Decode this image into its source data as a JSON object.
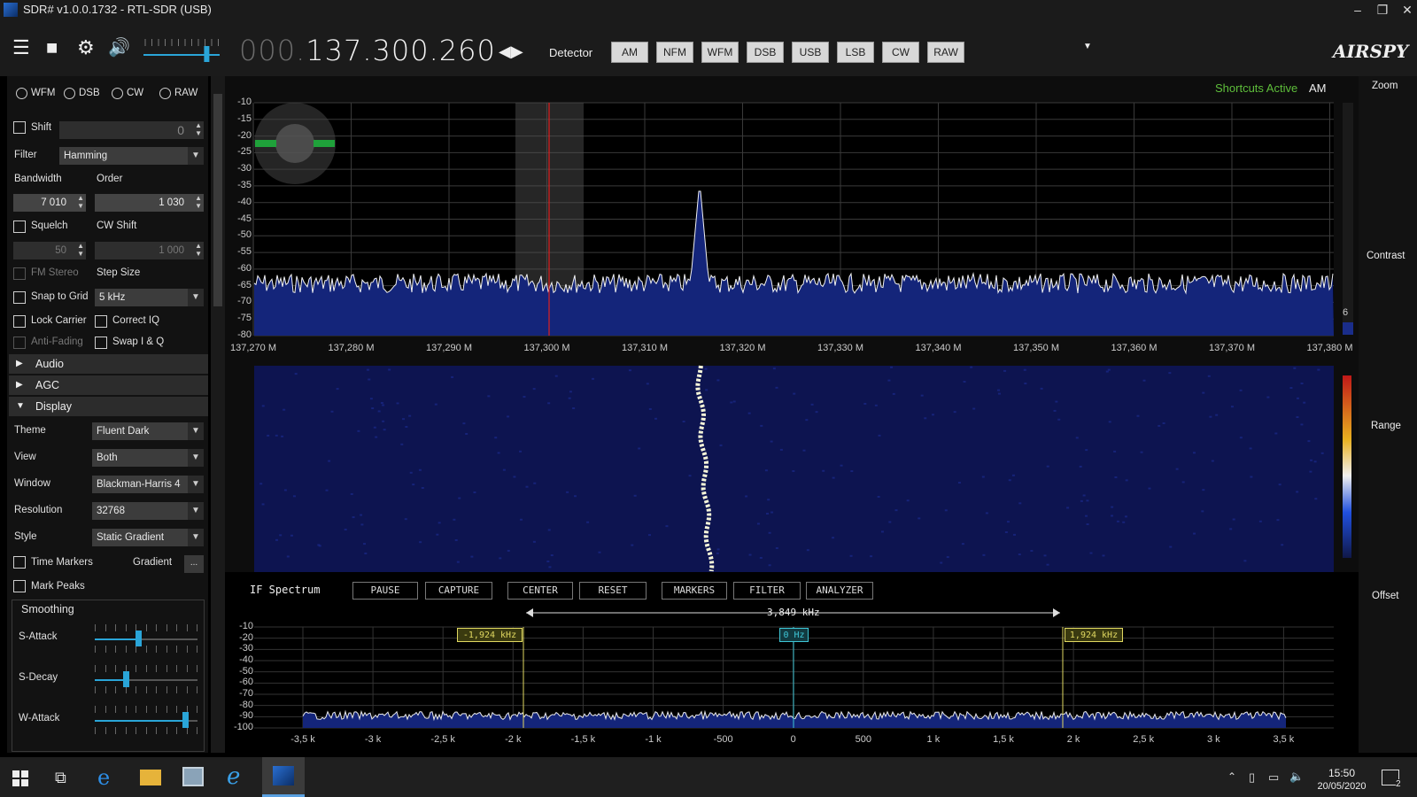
{
  "window": {
    "title": "SDR# v1.0.0.1732 - RTL-SDR (USB)",
    "minimize": "–",
    "maximize": "❐",
    "close": "✕"
  },
  "toolbar": {
    "menu_icon": "☰",
    "stop_icon": "■",
    "settings_icon": "⚙",
    "volume_icon": "🔊",
    "volume_level": 0.95,
    "freq_dim": "000.",
    "freq_main": "137.300.260",
    "detector_label": "Detector",
    "detectors": [
      "AM",
      "NFM",
      "WFM",
      "DSB",
      "USB",
      "LSB",
      "CW",
      "RAW"
    ],
    "logo": "AIRSPY"
  },
  "radio": {
    "modes": [
      "WFM",
      "DSB",
      "CW",
      "RAW"
    ],
    "shift_label": "Shift",
    "shift_value": "0",
    "filter_label": "Filter",
    "filter_value": "Hamming",
    "bandwidth_label": "Bandwidth",
    "bandwidth_value": "7 010",
    "order_label": "Order",
    "order_value": "1 030",
    "squelch_label": "Squelch",
    "squelch_value": "50",
    "cwshift_label": "CW Shift",
    "cwshift_value": "1 000",
    "fmstereo_label": "FM Stereo",
    "stepsize_label": "Step Size",
    "snap_label": "Snap to Grid",
    "snap_value": "5 kHz",
    "lockcarrier_label": "Lock Carrier",
    "correctiq_label": "Correct IQ",
    "antifading_label": "Anti-Fading",
    "swapiq_label": "Swap I & Q"
  },
  "sections": {
    "audio": "Audio",
    "agc": "AGC",
    "display": "Display"
  },
  "display": {
    "theme_label": "Theme",
    "theme_value": "Fluent Dark",
    "view_label": "View",
    "view_value": "Both",
    "window_label": "Window",
    "window_value": "Blackman-Harris 4",
    "resolution_label": "Resolution",
    "resolution_value": "32768",
    "style_label": "Style",
    "style_value": "Static Gradient",
    "timemarkers_label": "Time Markers",
    "gradient_label": "Gradient",
    "gradient_btn": "...",
    "markpeaks_label": "Mark Peaks",
    "smoothing_label": "Smoothing",
    "sattack_label": "S-Attack",
    "sattack_level": 0.42,
    "sdecay_label": "S-Decay",
    "sdecay_level": 0.3,
    "wattack_label": "W-Attack",
    "wattack_level": 0.88
  },
  "spectrum": {
    "shortcuts": "Shortcuts Active",
    "mode": "AM",
    "y_ticks": [
      "-10",
      "-15",
      "-20",
      "-25",
      "-30",
      "-35",
      "-40",
      "-45",
      "-50",
      "-55",
      "-60",
      "-65",
      "-70",
      "-75",
      "-80"
    ],
    "x_ticks": [
      "137,270 M",
      "137,280 M",
      "137,290 M",
      "137,300 M",
      "137,310 M",
      "137,320 M",
      "137,330 M",
      "137,340 M",
      "137,350 M",
      "137,360 M",
      "137,370 M",
      "137,380 M"
    ],
    "scale_num": "6"
  },
  "ifspectrum": {
    "label": "IF Spectrum",
    "buttons": [
      "PAUSE",
      "CAPTURE",
      "CENTER",
      "RESET",
      "MARKERS",
      "FILTER",
      "ANALYZER"
    ],
    "span": "3,849 kHz",
    "markers": [
      "-1,924 kHz",
      "0 Hz",
      "1,924 kHz"
    ],
    "y_ticks": [
      "-10",
      "-20",
      "-30",
      "-40",
      "-50",
      "-60",
      "-70",
      "-80",
      "-90",
      "-100"
    ],
    "x_ticks": [
      "-3,5 k",
      "-3 k",
      "-2,5 k",
      "-2 k",
      "-1,5 k",
      "-1 k",
      "-500",
      "0",
      "500",
      "1 k",
      "1,5 k",
      "2 k",
      "2,5 k",
      "3 k",
      "3,5 k"
    ]
  },
  "right": {
    "zoom": "Zoom",
    "contrast": "Contrast",
    "range": "Range",
    "offset": "Offset"
  },
  "taskbar": {
    "time": "15:50",
    "date": "20/05/2020",
    "notif": "2"
  },
  "colors": {
    "accent": "#2aa5d8",
    "shortcuts": "#5fbf3b",
    "marker": "#e0d860",
    "center_marker": "#3ec6d6",
    "spectrum_fill": "#14257a"
  }
}
